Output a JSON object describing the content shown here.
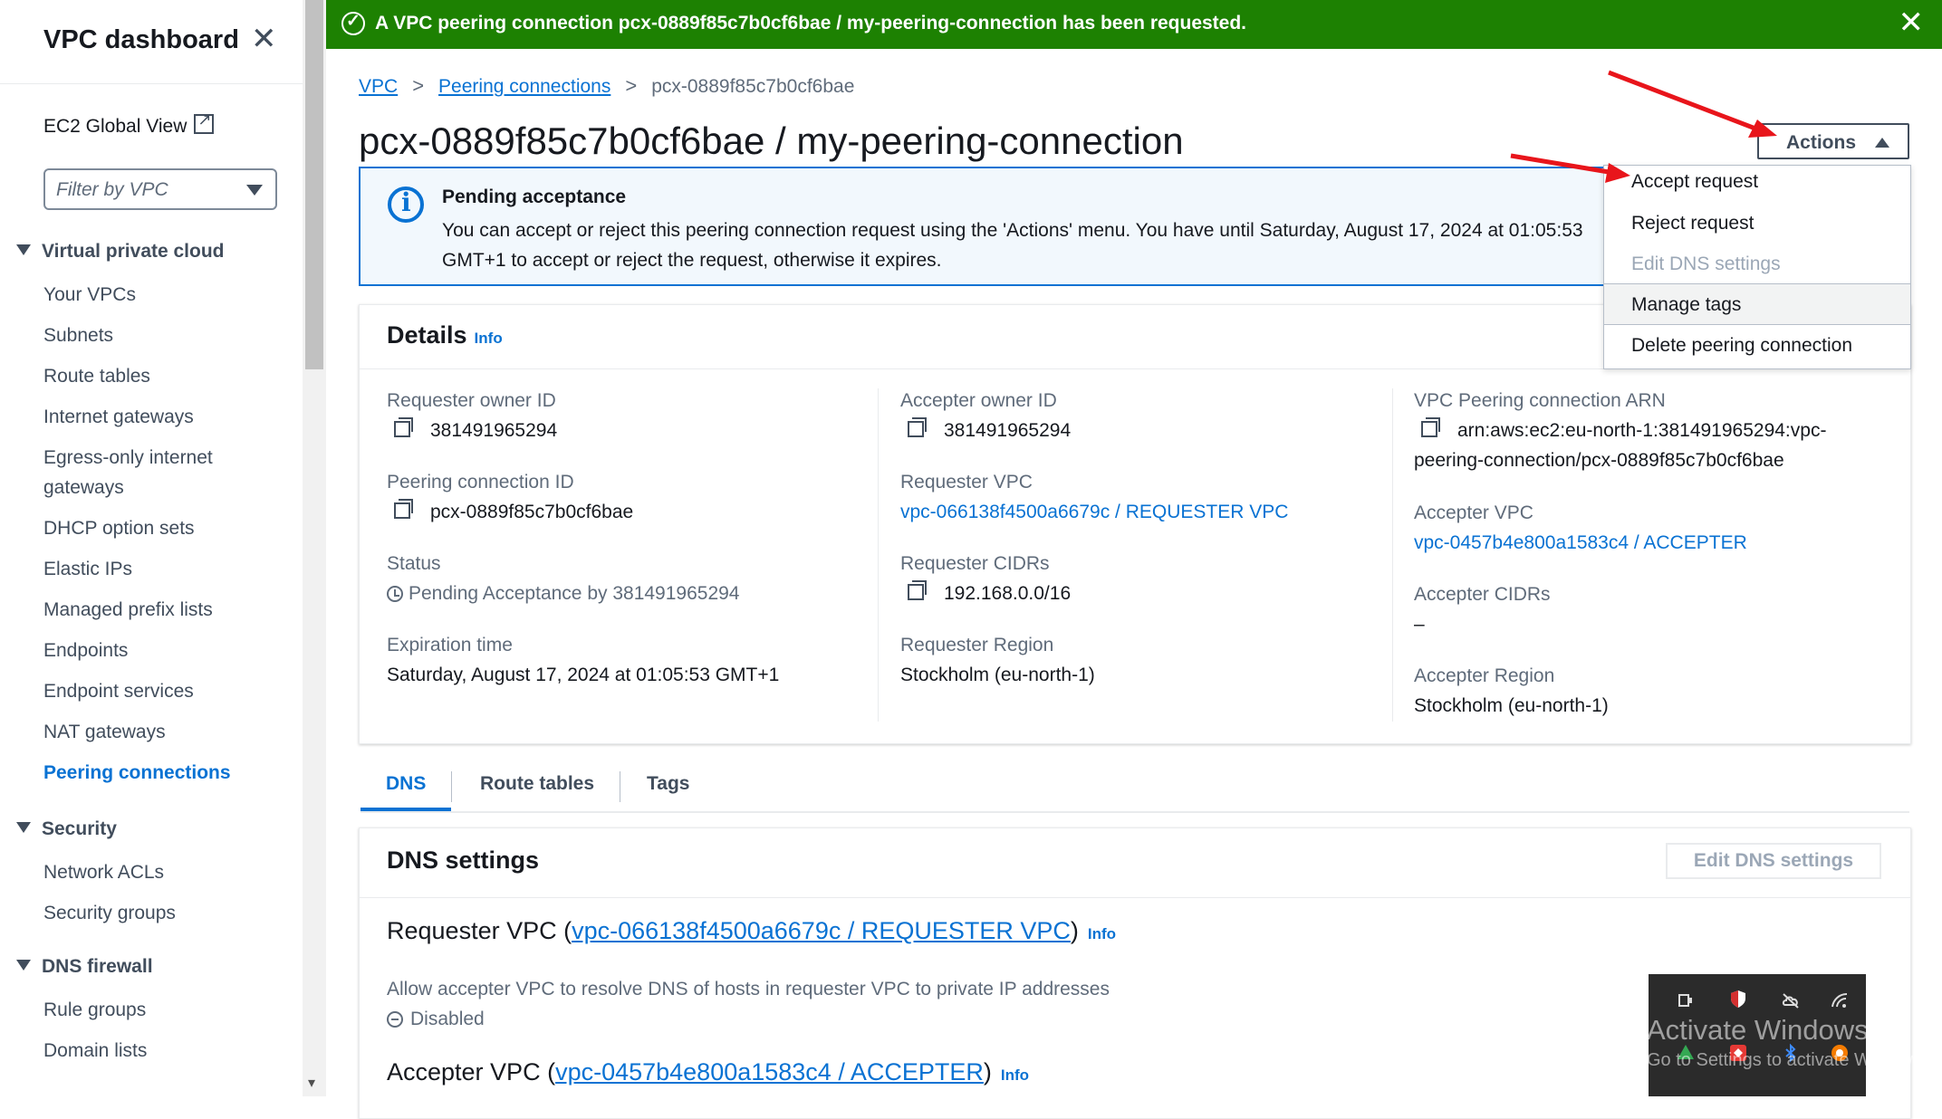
{
  "sidebar": {
    "title": "VPC dashboard",
    "ec2_global_view": "EC2 Global View",
    "filter_placeholder": "Filter by VPC",
    "sections": [
      {
        "label": "Virtual private cloud",
        "items": [
          "Your VPCs",
          "Subnets",
          "Route tables",
          "Internet gateways",
          "Egress-only internet",
          "gateways",
          "DHCP option sets",
          "Elastic IPs",
          "Managed prefix lists",
          "Endpoints",
          "Endpoint services",
          "NAT gateways",
          "Peering connections"
        ]
      },
      {
        "label": "Security",
        "items": [
          "Network ACLs",
          "Security groups"
        ]
      },
      {
        "label": "DNS firewall",
        "items": [
          "Rule groups",
          "Domain lists"
        ]
      }
    ],
    "active_item": "Peering connections"
  },
  "banner": {
    "prefix": "A VPC peering connection ",
    "bold": "pcx-0889f85c7b0cf6bae / my-peering-connection",
    "suffix": " has been requested.",
    "color": "#1d8102"
  },
  "breadcrumb": {
    "items": [
      "VPC",
      "Peering connections",
      "pcx-0889f85c7b0cf6bae"
    ]
  },
  "page_title": "pcx-0889f85c7b0cf6bae / my-peering-connection",
  "actions": {
    "label": "Actions",
    "menu": [
      "Accept request",
      "Reject request",
      "Edit DNS settings",
      "Manage tags",
      "Delete peering connection"
    ],
    "disabled": [
      "Edit DNS settings"
    ],
    "hovered": "Manage tags"
  },
  "alert": {
    "title": "Pending acceptance",
    "body": "You can accept or reject this peering connection request using the 'Actions' menu. You have until Saturday, August 17, 2024 at 01:05:53 GMT+1 to accept or reject the request, otherwise it expires."
  },
  "details": {
    "title": "Details",
    "info": "Info",
    "col1": {
      "requester_owner_label": "Requester owner ID",
      "requester_owner_value": "381491965294",
      "peering_id_label": "Peering connection ID",
      "peering_id_value": "pcx-0889f85c7b0cf6bae",
      "status_label": "Status",
      "status_value": "Pending Acceptance by 381491965294",
      "expiration_label": "Expiration time",
      "expiration_value": "Saturday, August 17, 2024 at 01:05:53 GMT+1"
    },
    "col2": {
      "accepter_owner_label": "Accepter owner ID",
      "accepter_owner_value": "381491965294",
      "requester_vpc_label": "Requester VPC",
      "requester_vpc_value": "vpc-066138f4500a6679c / REQUESTER VPC",
      "requester_cidrs_label": "Requester CIDRs",
      "requester_cidrs_value": "192.168.0.0/16",
      "requester_region_label": "Requester Region",
      "requester_region_value": "Stockholm (eu-north-1)"
    },
    "col3": {
      "arn_label": "VPC Peering connection ARN",
      "arn_value_line1": "arn:aws:ec2:eu-north-1:381491965294:vpc-",
      "arn_value_line2": "peering-connection/pcx-0889f85c7b0cf6bae",
      "accepter_vpc_label": "Accepter VPC",
      "accepter_vpc_value": "vpc-0457b4e800a1583c4 / ACCEPTER",
      "accepter_cidrs_label": "Accepter CIDRs",
      "accepter_cidrs_value": "–",
      "accepter_region_label": "Accepter Region",
      "accepter_region_value": "Stockholm (eu-north-1)"
    }
  },
  "tabs": {
    "items": [
      "DNS",
      "Route tables",
      "Tags"
    ],
    "active": "DNS"
  },
  "dns": {
    "title": "DNS settings",
    "edit_button": "Edit DNS settings",
    "requester_prefix": "Requester VPC (",
    "requester_link": "vpc-066138f4500a6679c / REQUESTER VPC",
    "suffix": ")",
    "info": "Info",
    "allow_label": "Allow accepter VPC to resolve DNS of hosts in requester VPC to private IP addresses",
    "allow_value": "Disabled",
    "accepter_prefix": "Accepter VPC (",
    "accepter_link": "vpc-0457b4e800a1583c4 / ACCEPTER"
  },
  "overlay": {
    "watermark_line1": "Activate Windows",
    "watermark_line2": "Go to Settings to activate Windows."
  },
  "annotation_arrow_color": "#e8151b"
}
